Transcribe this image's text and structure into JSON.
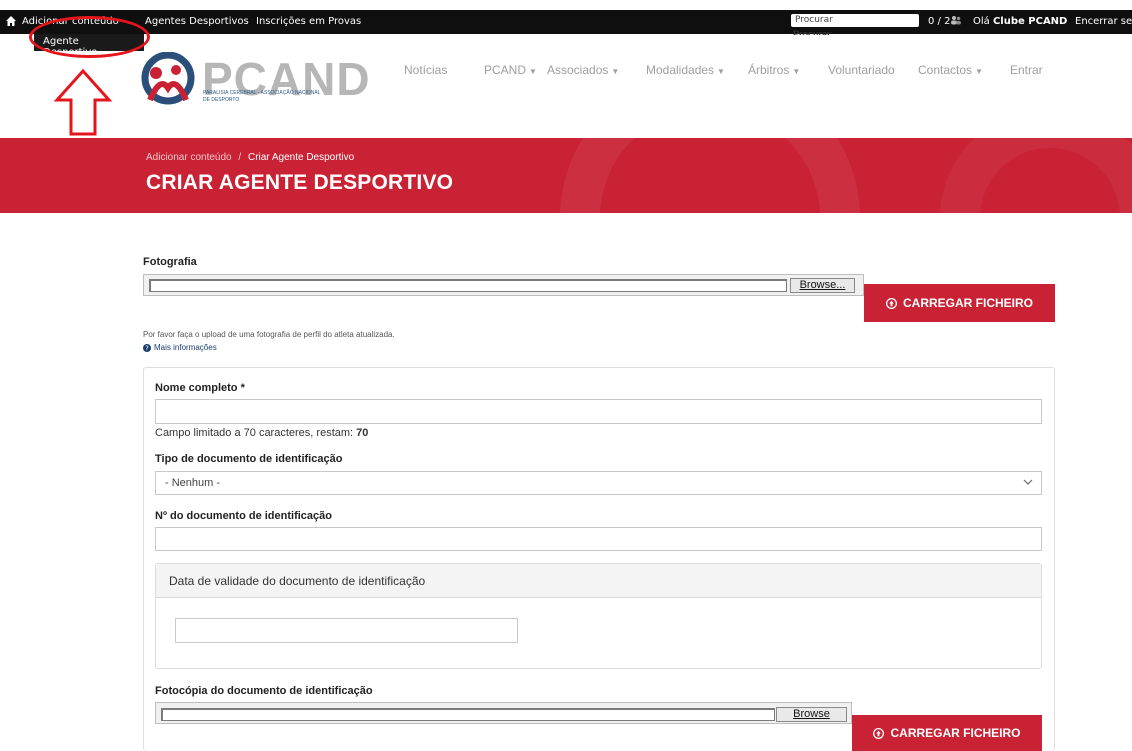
{
  "toolbar": {
    "add_content": "Adicionar conteúdo",
    "sports_agents": "Agentes Desportivos",
    "competition_entries": "Inscrições em Provas",
    "search_placeholder": "Procurar",
    "counter": "0 / 2",
    "greeting": "Olá",
    "user": "Clube PCAND",
    "logout": "Encerrar sess"
  },
  "dropdown": {
    "item": "Agente Desportivo"
  },
  "search_label_cut": "Procurar",
  "logo": {
    "brand": "PCAND",
    "tagline": "Paralisia Cerebral - Associação Nacional de Desporto"
  },
  "nav": [
    "Notícias",
    "PCAND",
    "Associados",
    "Modalidades",
    "Árbitros",
    "Voluntariado",
    "Contactos",
    "Entrar"
  ],
  "breadcrumb": {
    "parent": "Adicionar conteúdo",
    "separator": "/",
    "current": "Criar Agente Desportivo"
  },
  "page_title": "CRIAR AGENTE DESPORTIVO",
  "form": {
    "photo_label": "Fotografia",
    "browse_label": "Browse...",
    "upload_label": "CARREGAR FICHEIRO",
    "photo_help": "Por favor faça o upload de uma fotografia de perfil do atleta atualizada.",
    "more_info": "Mais informações",
    "full_name_label": "Nome completo *",
    "char_limit_prefix": "Campo limitado a 70 caracteres, restam:",
    "char_limit_remaining": "70",
    "doc_type_label": "Tipo de documento de identificação",
    "doc_type_value": "- Nenhum -",
    "doc_number_label": "Nº do documento de identificação",
    "doc_expiry_label": "Data de validade do documento de identificação",
    "doc_copy_label": "Fotocópia do documento de identificação",
    "browse_label_2": "Browse",
    "upload_label_2": "CARREGAR FICHEIRO"
  },
  "colors": {
    "brand_red": "#c92234",
    "toolbar": "#0f0f0f",
    "annotation": "#e4161c"
  },
  "icons": [
    "home-icon",
    "users-icon",
    "upload-icon",
    "info-icon",
    "chevron-down-icon"
  ]
}
